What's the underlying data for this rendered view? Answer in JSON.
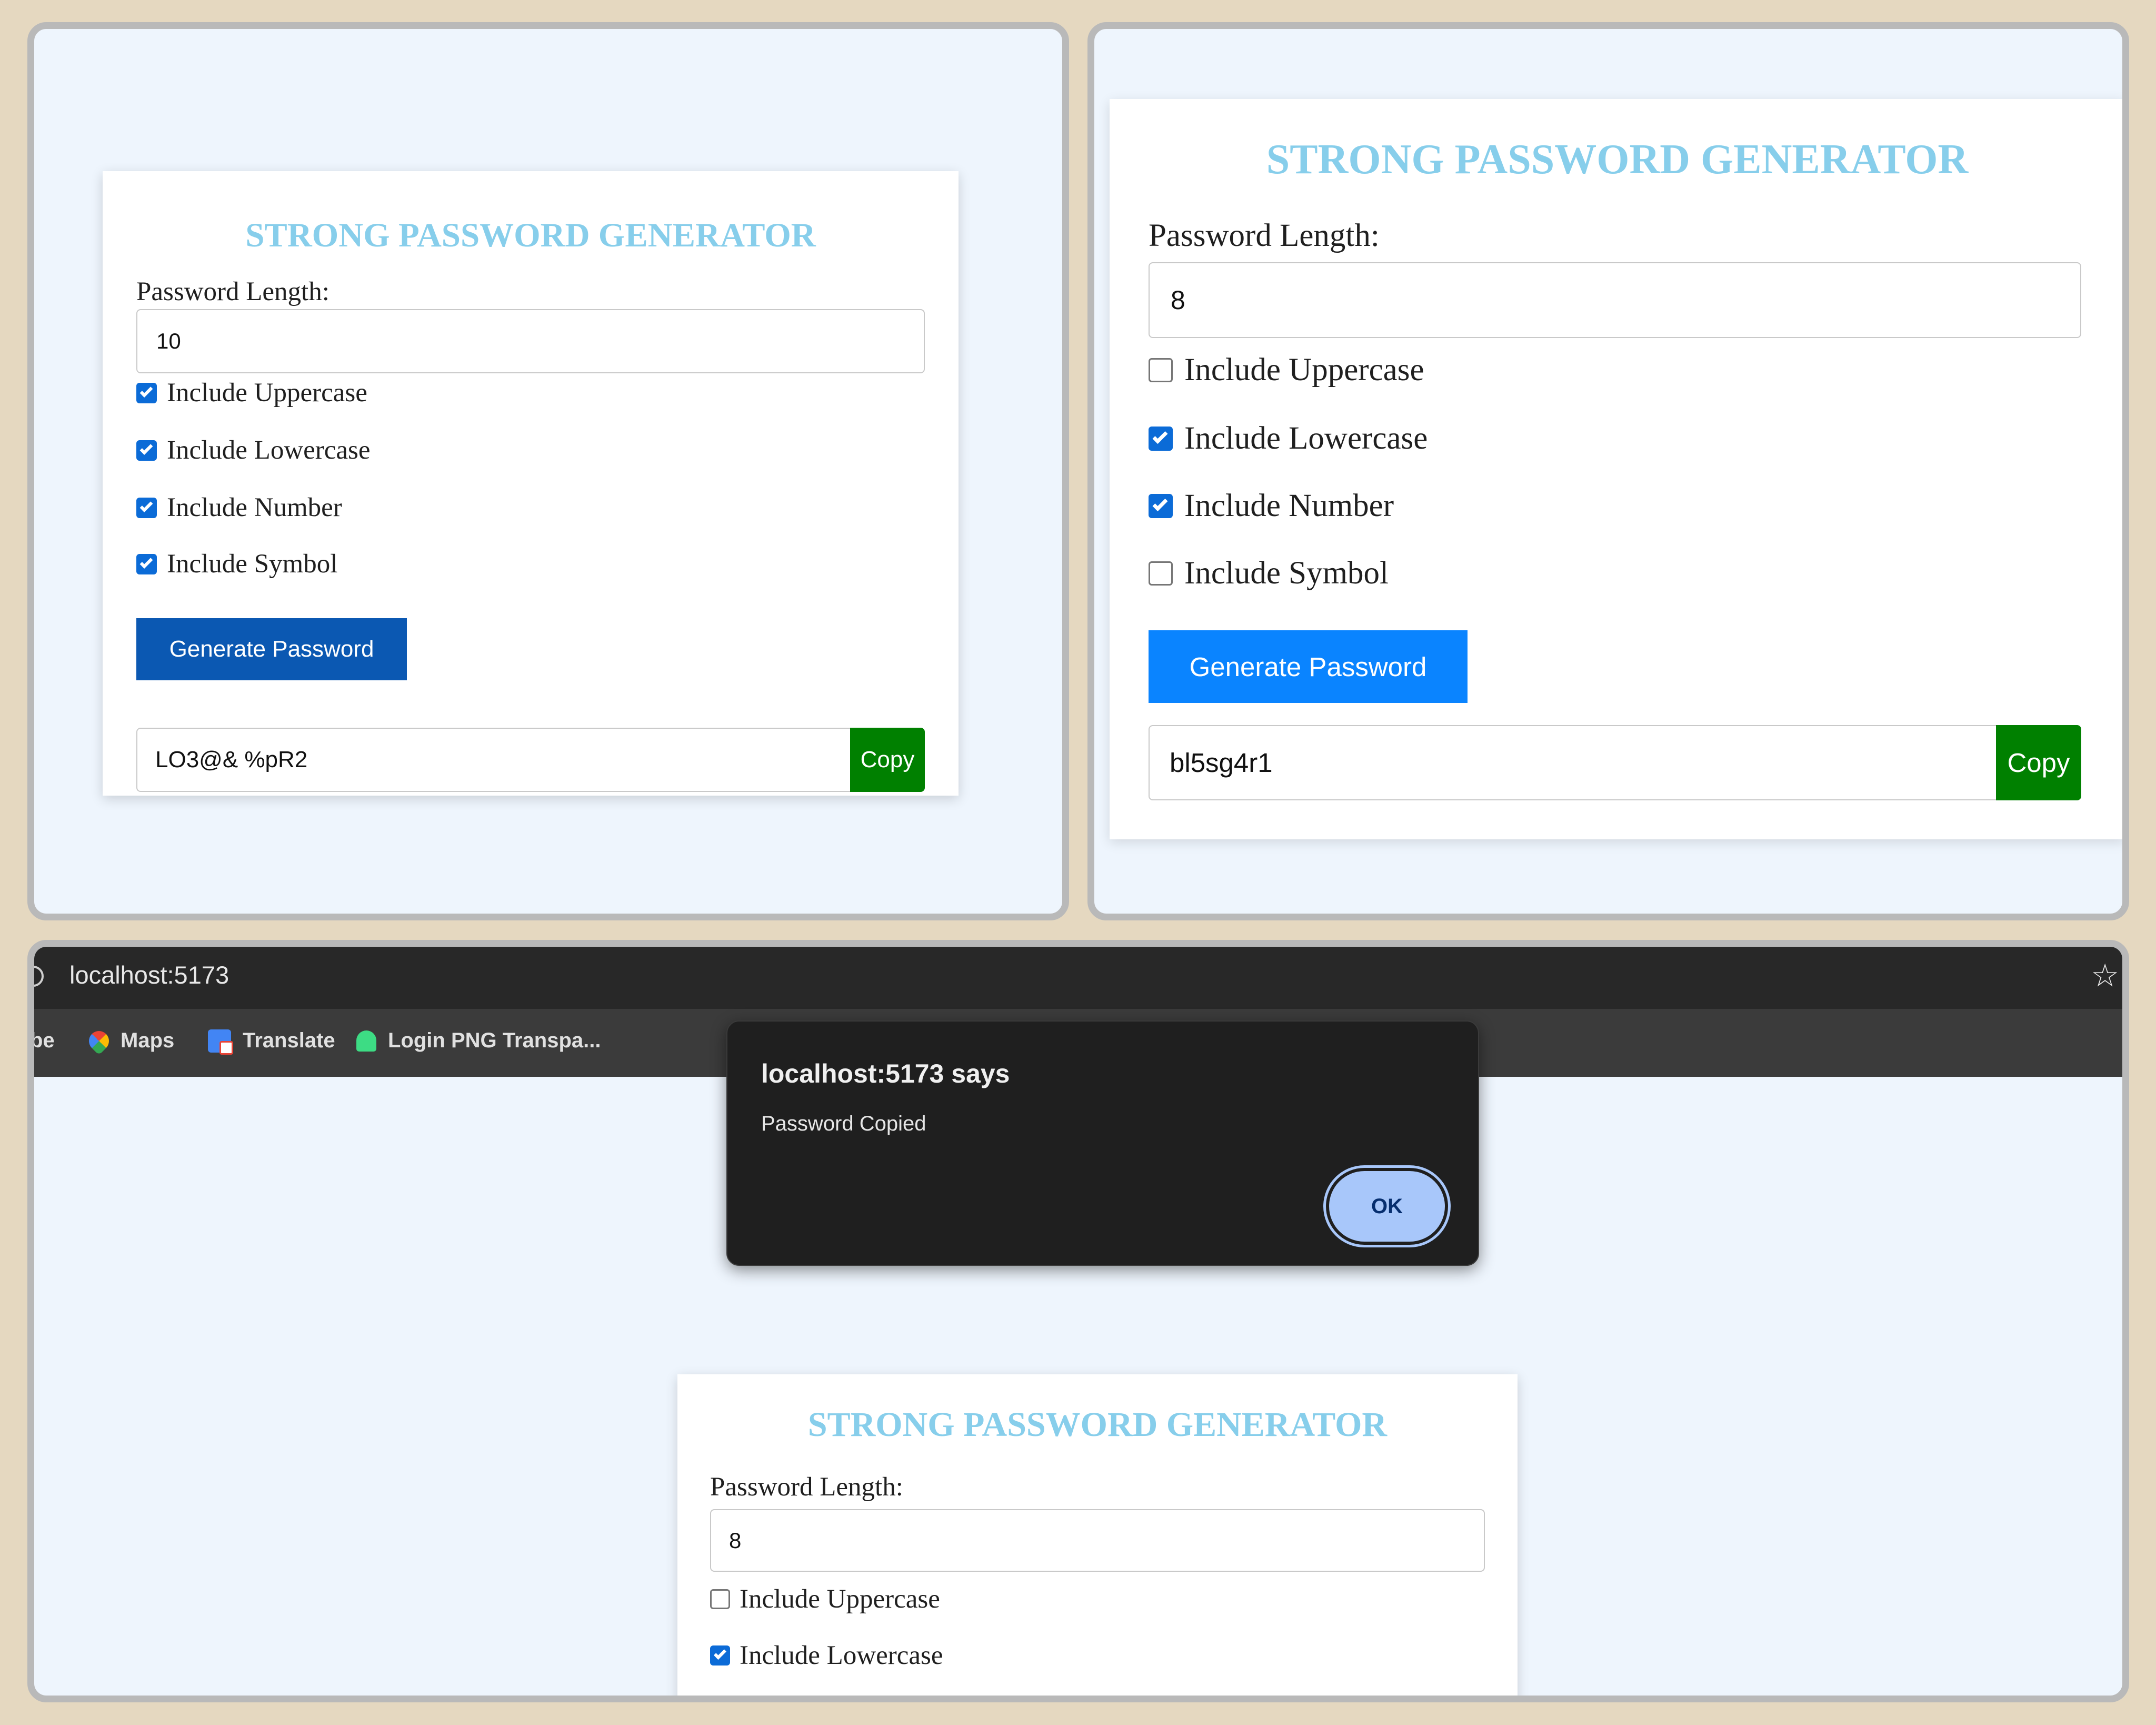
{
  "colors": {
    "title": "#87ceeb",
    "generate_dark": "#0b58b2",
    "generate_bright": "#0a84ff",
    "copy": "#008000",
    "checkbox_checked": "#0b6bd7",
    "page_bg": "#eef5fd"
  },
  "card_a": {
    "title": "STRONG PASSWORD GENERATOR",
    "length_label": "Password Length:",
    "length_value": "10",
    "options": [
      {
        "label": "Include Uppercase",
        "checked": true
      },
      {
        "label": "Include Lowercase",
        "checked": true
      },
      {
        "label": "Include Number",
        "checked": true
      },
      {
        "label": "Include Symbol",
        "checked": true
      }
    ],
    "generate_label": "Generate Password",
    "password": "LO3@& %pR2",
    "copy_label": "Copy"
  },
  "card_b": {
    "title": "STRONG PASSWORD GENERATOR",
    "length_label": "Password Length:",
    "length_value": "8",
    "options": [
      {
        "label": "Include Uppercase",
        "checked": false
      },
      {
        "label": "Include Lowercase",
        "checked": true
      },
      {
        "label": "Include Number",
        "checked": true
      },
      {
        "label": "Include Symbol",
        "checked": false
      }
    ],
    "generate_label": "Generate Password",
    "password": "bl5sg4r1",
    "copy_label": "Copy"
  },
  "browser": {
    "url": "localhost:5173",
    "bookmarks": [
      "be",
      "Maps",
      "Translate",
      "Login PNG Transpa..."
    ],
    "icons": [
      "site-info-icon",
      "star-icon",
      "maps-icon",
      "translate-icon",
      "android-icon"
    ]
  },
  "dialog": {
    "title": "localhost:5173 says",
    "message": "Password Copied",
    "ok_label": "OK"
  },
  "card_c": {
    "title": "STRONG PASSWORD GENERATOR",
    "length_label": "Password Length:",
    "length_value": "8",
    "options": [
      {
        "label": "Include Uppercase",
        "checked": false
      },
      {
        "label": "Include Lowercase",
        "checked": true
      }
    ]
  }
}
